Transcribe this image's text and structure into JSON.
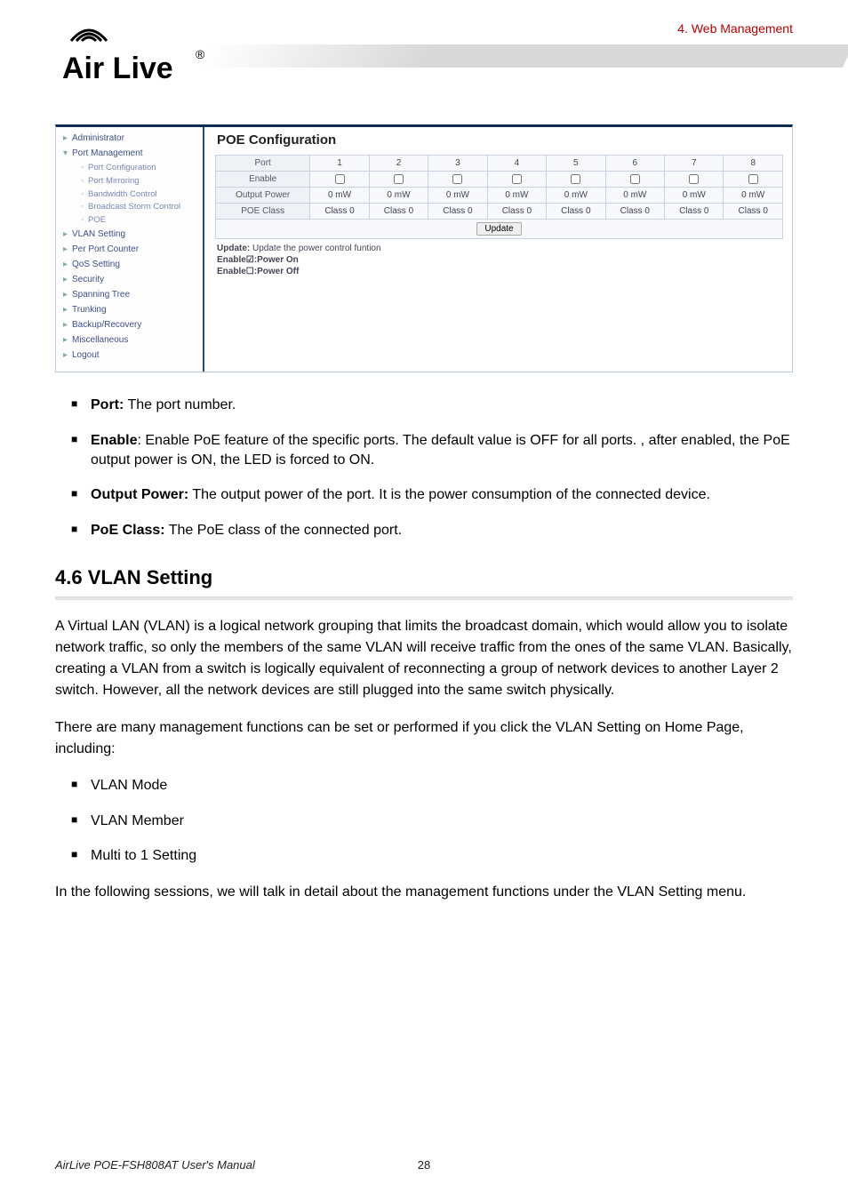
{
  "header": {
    "breadcrumb": "4.  Web Management",
    "logo_brand": "Air Live",
    "logo_reg": "®"
  },
  "app": {
    "sidebar": {
      "groups": [
        "Administrator",
        "Port Management",
        "VLAN Setting",
        "Per Port Counter",
        "QoS Setting",
        "Security",
        "Spanning Tree",
        "Trunking",
        "Backup/Recovery",
        "Miscellaneous",
        "Logout"
      ],
      "subitems": [
        "Port Configuration",
        "Port Mirroring",
        "Bandwidth Control",
        "Broadcast Storm Control",
        "POE"
      ]
    },
    "panel": {
      "title": "POE Configuration",
      "cols": [
        "1",
        "2",
        "3",
        "4",
        "5",
        "6",
        "7",
        "8"
      ],
      "rows": {
        "port": "Port",
        "enable": "Enable",
        "output": "Output Power",
        "class": "POE Class"
      },
      "output_val": "0 mW",
      "class_val": "Class 0",
      "update": "Update",
      "notes_update_label": "Update:",
      "notes_update_text": " Update the power control funtion",
      "notes_on": "Enable☑:Power On",
      "notes_off": "Enable☐:Power Off"
    }
  },
  "body": {
    "b1_label": "Port:",
    "b1_text": " The port number.",
    "b2_label": "Enable",
    "b2_text": ": Enable PoE feature of the specific ports. The default value is OFF for all ports. , after enabled, the PoE output power is ON, the LED is forced to ON.",
    "b3_label": "Output Power:",
    "b3_text": " The output power of the port. It is the power consumption of the connected device.",
    "b4_label": "PoE Class:",
    "b4_text": " The PoE class of the connected port.",
    "section_title": "4.6 VLAN Setting",
    "p1": "A Virtual LAN (VLAN) is a logical network grouping that limits the broadcast domain, which would allow you to isolate network traffic, so only the members of the same VLAN will receive traffic from the ones of the same VLAN. Basically, creating a VLAN from a switch is logically equivalent of reconnecting a group of network devices to another Layer 2 switch. However, all the network devices are still plugged into the same switch physically.",
    "p2": "There are many management functions can be set or performed if you click the VLAN Setting on Home Page, including:",
    "li1": "VLAN Mode",
    "li2": "VLAN Member",
    "li3": "Multi to 1 Setting",
    "p3": "In the following sessions, we will talk in detail about the management functions under the VLAN Setting menu.",
    "footer_manual": "AirLive POE-FSH808AT User's Manual",
    "footer_page": "28"
  }
}
